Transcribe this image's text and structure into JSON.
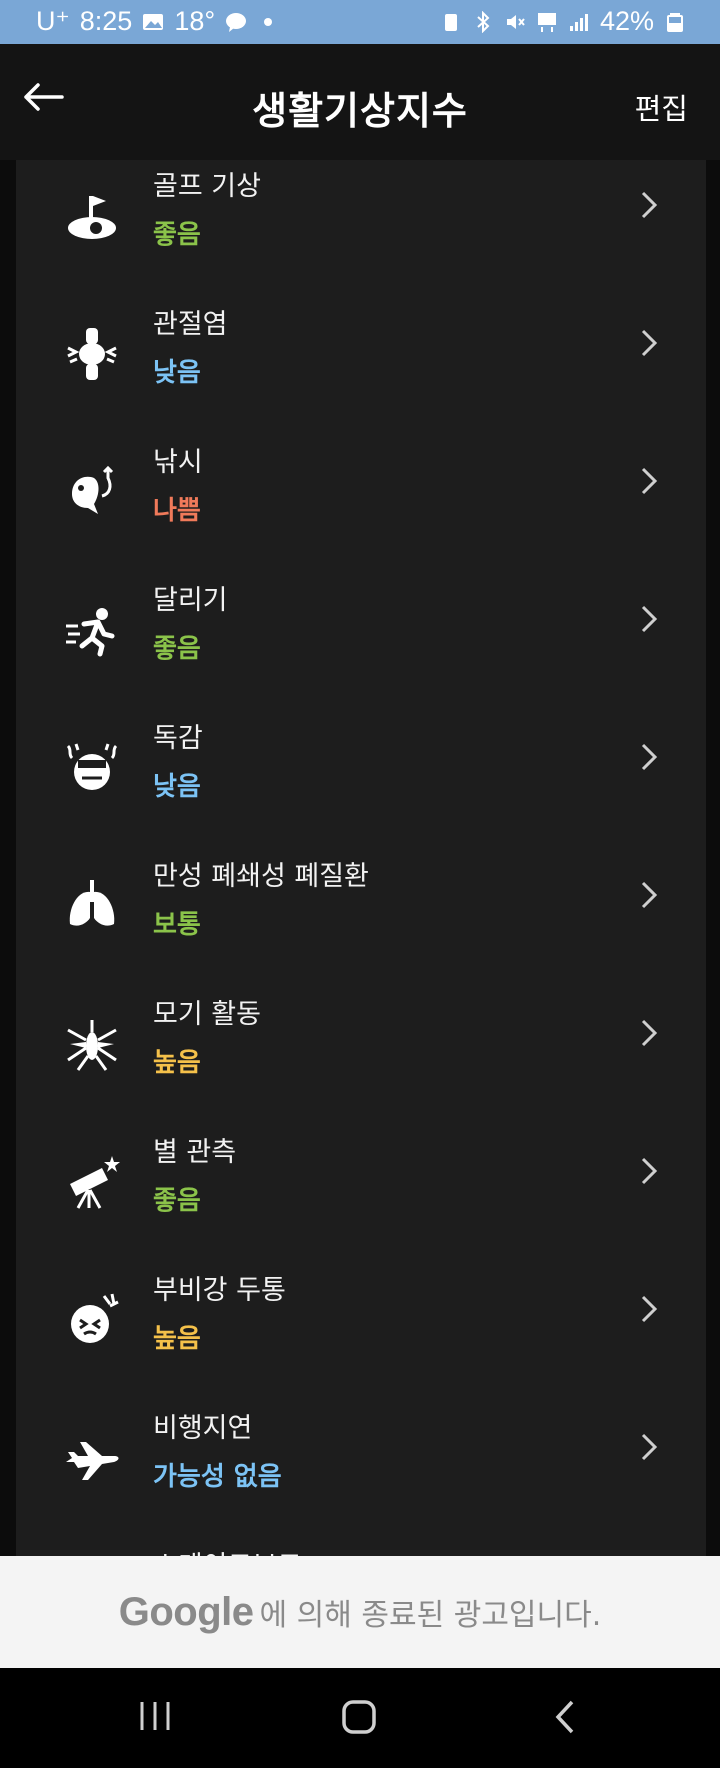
{
  "status_bar": {
    "carrier": "U⁺",
    "time": "8:25",
    "temp": "18°",
    "battery": "42%"
  },
  "header": {
    "title": "생활기상지수",
    "edit_label": "편집"
  },
  "colors": {
    "good": "#8bc34a",
    "low": "#7cc3f5",
    "bad": "#f07a5a",
    "high": "#f5c14a"
  },
  "items": [
    {
      "name": "골프 기상",
      "status": "좋음",
      "status_color": "#8bc34a",
      "icon": "golf-icon"
    },
    {
      "name": "관절염",
      "status": "낮음",
      "status_color": "#7cc3f5",
      "icon": "joint-icon"
    },
    {
      "name": "낚시",
      "status": "나쁨",
      "status_color": "#f07a5a",
      "icon": "fishing-icon"
    },
    {
      "name": "달리기",
      "status": "좋음",
      "status_color": "#8bc34a",
      "icon": "running-icon"
    },
    {
      "name": "독감",
      "status": "낮음",
      "status_color": "#7cc3f5",
      "icon": "flu-icon"
    },
    {
      "name": "만성 폐쇄성 폐질환",
      "status": "보통",
      "status_color": "#8bc34a",
      "icon": "lungs-icon"
    },
    {
      "name": "모기 활동",
      "status": "높음",
      "status_color": "#f5c14a",
      "icon": "mosquito-icon"
    },
    {
      "name": "별 관측",
      "status": "좋음",
      "status_color": "#8bc34a",
      "icon": "telescope-icon"
    },
    {
      "name": "부비강 두통",
      "status": "높음",
      "status_color": "#f5c14a",
      "icon": "headache-icon"
    },
    {
      "name": "비행지연",
      "status": "가능성 없음",
      "status_color": "#7cc3f5",
      "icon": "airplane-icon"
    },
    {
      "name": "스케이트보드",
      "status": "",
      "status_color": "#8bc34a",
      "icon": "skateboard-icon"
    }
  ],
  "ad": {
    "brand": "Google",
    "text": "에 의해 종료된 광고입니다."
  }
}
